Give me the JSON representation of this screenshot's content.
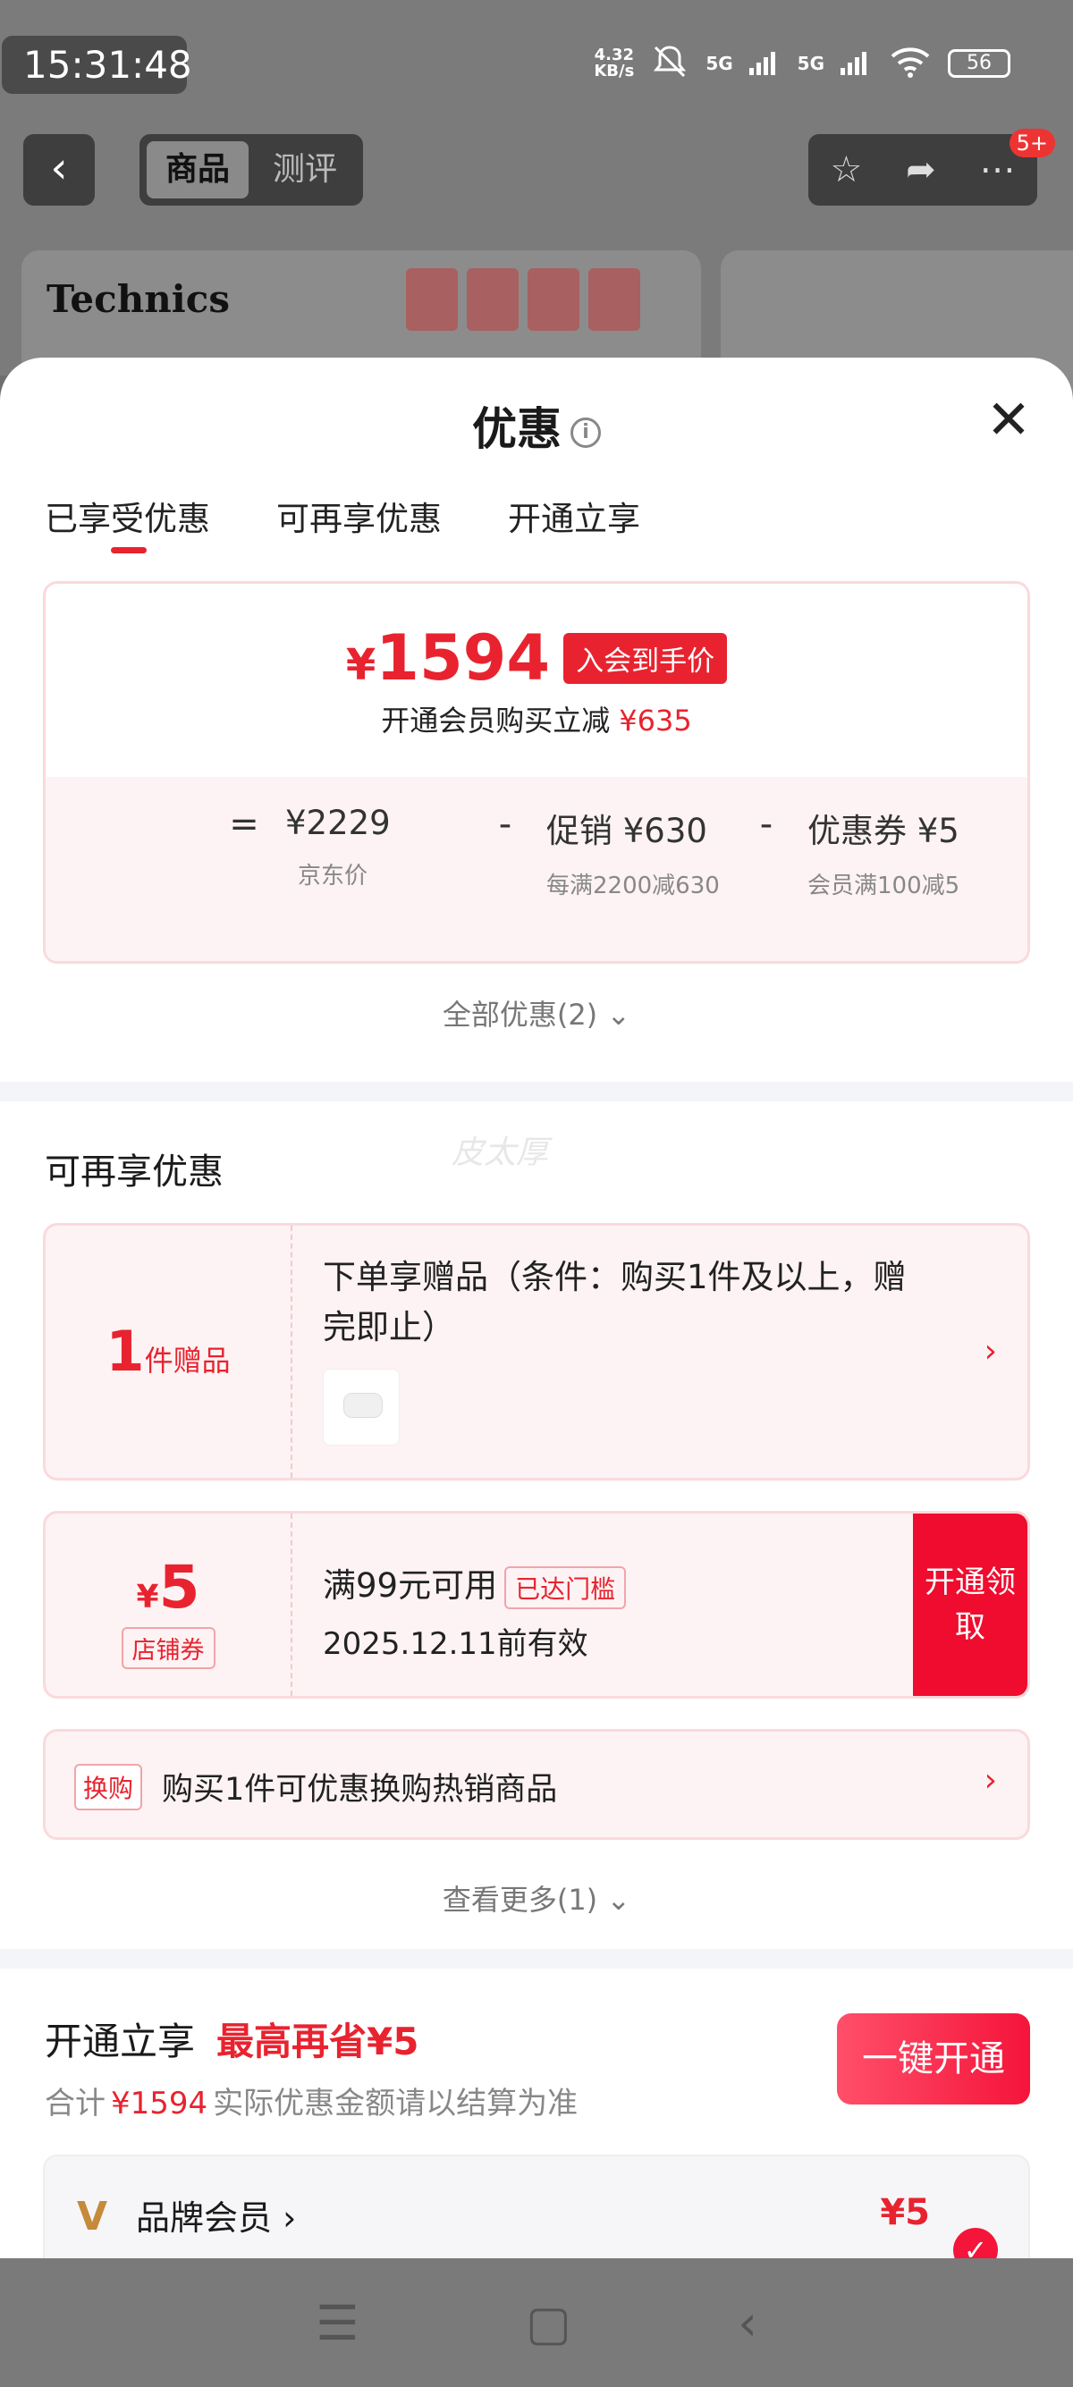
{
  "status_bar": {
    "time": "15:31:48",
    "net_speed": "4.32",
    "net_unit": "KB/s",
    "signal1": "5G",
    "signal2": "5G",
    "battery": "56"
  },
  "nav": {
    "tabs": [
      "商品",
      "测评"
    ],
    "badge": "5+"
  },
  "banner": {
    "brand": "Technics"
  },
  "sheet": {
    "title": "优惠",
    "tabs": [
      "已享受优惠",
      "可再享优惠",
      "开通立享"
    ],
    "price_card": {
      "price": "1594",
      "currency": "¥",
      "tag": "入会到手价",
      "sub_text": "开通会员购买立减",
      "sub_amount": "¥635",
      "calc": [
        {
          "op": "=",
          "value": "¥2229",
          "label": "京东价"
        },
        {
          "op": "-",
          "value": "促销 ¥630",
          "label": "每满2200减630"
        },
        {
          "op": "-",
          "value": "优惠券 ¥5",
          "label": "会员满100减5"
        }
      ]
    },
    "all_offers": "全部优惠(2)",
    "more_section_title": "可再享优惠",
    "watermark": "皮太厚",
    "gift": {
      "num": "1",
      "unit": "件赠品",
      "text": "下单享赠品（条件：购买1件及以上，赠完即止）"
    },
    "coupon": {
      "amount": "5",
      "currency": "¥",
      "type": "店铺券",
      "condition": "满99元可用",
      "badge": "已达门槛",
      "expiry": "2025.12.11前有效",
      "button": "开通领取"
    },
    "swap": {
      "tag": "换购",
      "text": "购买1件可优惠换购热销商品"
    },
    "see_more": "查看更多(1)",
    "open": {
      "title": "开通立享",
      "highlight": "最高再省¥5",
      "sub_prefix": "合计",
      "sub_amount": "¥1594",
      "sub_suffix": "实际优惠金额请以结算为准",
      "button": "一键开通"
    },
    "brand_member": {
      "title": "品牌会员 ›",
      "price": "¥5"
    }
  }
}
